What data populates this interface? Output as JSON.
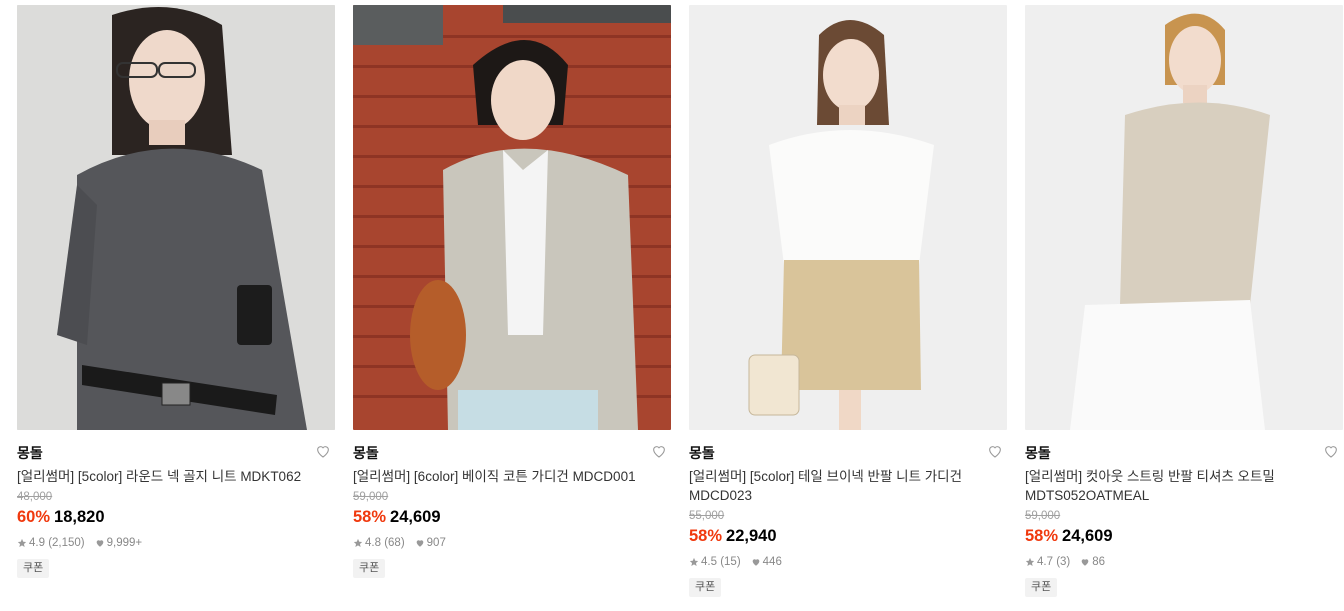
{
  "products": [
    {
      "brand": "몽돌",
      "title": "[얼리썸머] [5color] 라운드 넥 골지 니트 MDKT062",
      "original_price": "48,000",
      "discount": "60%",
      "price": "18,820",
      "rating": "4.9",
      "reviews": "(2,150)",
      "likes": "9,999+",
      "badge": "쿠폰"
    },
    {
      "brand": "몽돌",
      "title": "[얼리썸머] [6color] 베이직 코튼 가디건 MDCD001",
      "original_price": "59,000",
      "discount": "58%",
      "price": "24,609",
      "rating": "4.8",
      "reviews": "(68)",
      "likes": "907",
      "badge": "쿠폰"
    },
    {
      "brand": "몽돌",
      "title": "[얼리썸머] [5color] 테일 브이넥 반팔 니트 가디건 MDCD023",
      "original_price": "55,000",
      "discount": "58%",
      "price": "22,940",
      "rating": "4.5",
      "reviews": "(15)",
      "likes": "446",
      "badge": "쿠폰"
    },
    {
      "brand": "몽돌",
      "title": "[얼리썸머] 컷아웃 스트링 반팔 티셔츠 오트밀 MDTS052OATMEAL",
      "original_price": "59,000",
      "discount": "58%",
      "price": "24,609",
      "rating": "4.7",
      "reviews": "(3)",
      "likes": "86",
      "badge": "쿠폰"
    }
  ],
  "colors": {
    "discount": "#f0390e",
    "price": "#000000",
    "muted": "#888888"
  },
  "icons": {
    "wishlist": "heart-outline-icon",
    "rating": "star-icon",
    "likes": "heart-filled-icon"
  }
}
